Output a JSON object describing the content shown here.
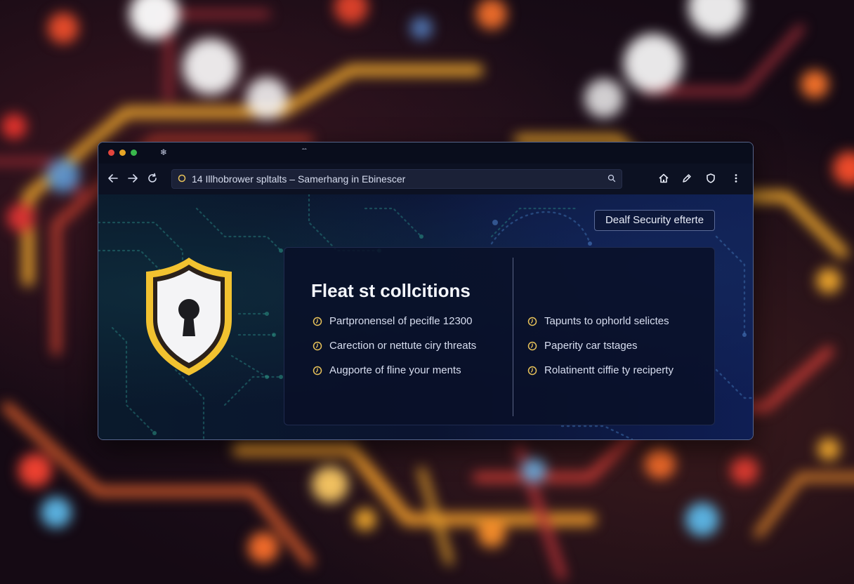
{
  "browser": {
    "address_text": "14 Illhobrower spltalts – Samerhang in Ebinescer",
    "titlebar_glyph_1": "❄",
    "titlebar_glyph_2": "ˆˆ"
  },
  "icons": {
    "back": "arrow-left-icon",
    "forward": "arrow-right-icon",
    "reload": "reload-icon",
    "lock": "lock-icon",
    "search": "search-icon",
    "home": "home-icon",
    "pen": "pen-icon",
    "shield": "shield-icon",
    "menu": "more-vertical-icon",
    "bullet": "clock-bullet-icon"
  },
  "page": {
    "alert_button": "Dealf Security efterte",
    "card_title": "Fleat st collcitions",
    "left_items": [
      "Partpronensel of pecifle 12300",
      "Carection or nettute ciry threats",
      "Augporte of fline your ments"
    ],
    "right_items": [
      "Tapunts to ophorld selictes",
      "Paperity car tstages",
      "Rolatinentt ciffie ty reciperty"
    ]
  },
  "colors": {
    "accent_yellow": "#f2c230",
    "window_bg": "#0b1126",
    "address_bar": "#1b2137",
    "bullet": "#e9c35a"
  }
}
